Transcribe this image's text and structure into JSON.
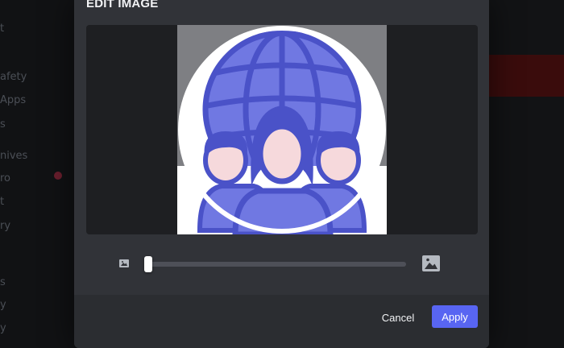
{
  "modal": {
    "title": "EDIT IMAGE",
    "cancel_label": "Cancel",
    "apply_label": "Apply"
  },
  "zoom": {
    "value": 0.0
  },
  "background": {
    "sidebar_items": [
      "t",
      "afety",
      "Apps",
      "s",
      "nives",
      "ro",
      "t",
      "ry",
      "s",
      "y",
      "y"
    ]
  },
  "colors": {
    "accent": "#5865f2",
    "modal_bg": "#313338",
    "footer_bg": "#2b2d31",
    "crop_bg": "#1e1f22",
    "photo_bg": "#7e7f83",
    "avatar_blue": "#7077e0",
    "avatar_dark_blue": "#4a52c8",
    "avatar_skin": "#f6d9dc"
  },
  "icons": {
    "small_image": "image-icon",
    "large_image": "image-icon"
  }
}
